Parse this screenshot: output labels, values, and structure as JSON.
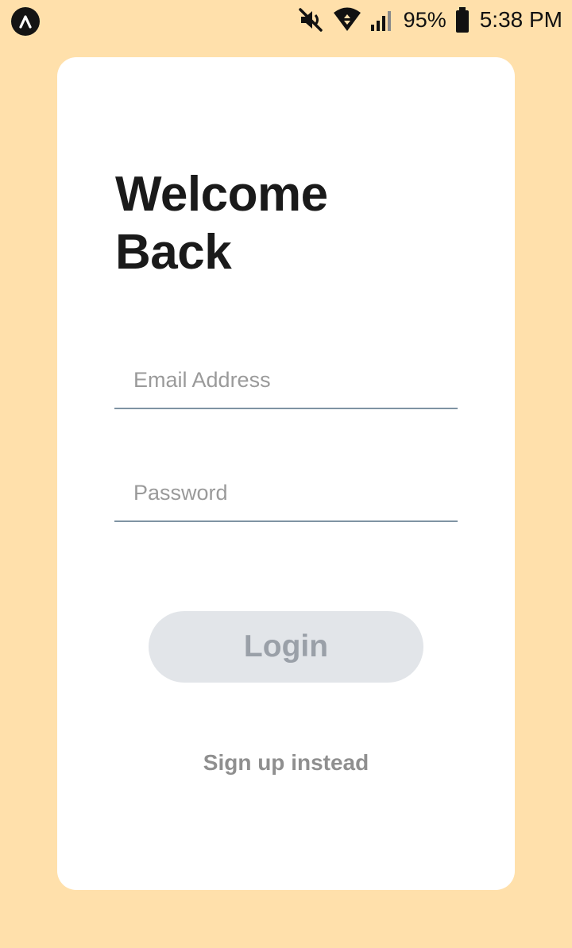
{
  "status_bar": {
    "app_icon": "astro-caret-icon",
    "mute_icon": "volume-off-icon",
    "wifi_icon": "wifi-data-transfer-icon",
    "signal_icon": "cellular-signal-icon",
    "battery_text": "95%",
    "battery_icon": "battery-icon",
    "time": "5:38 PM"
  },
  "login_card": {
    "title": "Welcome\nBack",
    "email_placeholder": "Email Address",
    "password_placeholder": "Password",
    "login_label": "Login",
    "signup_label": "Sign up instead"
  },
  "colors": {
    "background": "#ffe0ab",
    "card": "#ffffff",
    "title": "#1a1a1a",
    "field_border": "#7f93a3",
    "button_bg": "#e2e5e9",
    "button_text": "#9aa0a8",
    "secondary_text": "#8f8f8f"
  }
}
